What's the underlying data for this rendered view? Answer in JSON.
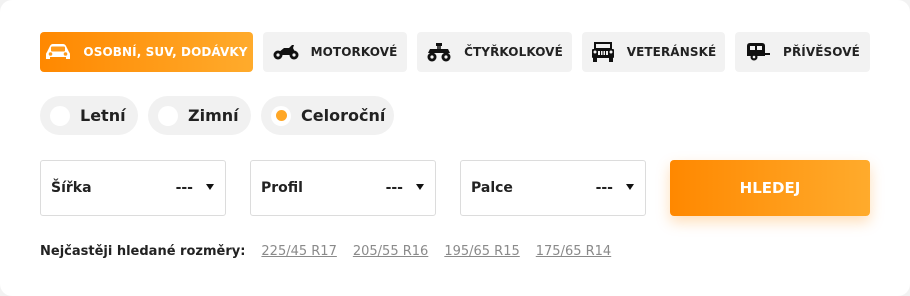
{
  "vehicle_tabs": [
    {
      "label": "OSOBNÍ, SUV, DODÁVKY",
      "icon": "car-icon",
      "active": true
    },
    {
      "label": "MOTORKOVÉ",
      "icon": "motorcycle-icon",
      "active": false
    },
    {
      "label": "ČTYŘKOLKOVÉ",
      "icon": "quad-bike-icon",
      "active": false
    },
    {
      "label": "VETERÁNSKÉ",
      "icon": "vintage-car-icon",
      "active": false
    },
    {
      "label": "PŘÍVĚSOVÉ",
      "icon": "trailer-icon",
      "active": false
    }
  ],
  "seasons": [
    {
      "label": "Letní",
      "selected": false
    },
    {
      "label": "Zimní",
      "selected": false
    },
    {
      "label": "Celoroční",
      "selected": true
    }
  ],
  "filters": [
    {
      "label": "Šířka",
      "value": "---"
    },
    {
      "label": "Profil",
      "value": "---"
    },
    {
      "label": "Palce",
      "value": "---"
    }
  ],
  "search_button": "HLEDEJ",
  "popular": {
    "title": "Nejčastěji hledané rozměry:",
    "sizes": [
      "225/45 R17",
      "205/55 R16",
      "195/65 R15",
      "175/65 R14"
    ]
  },
  "colors": {
    "accent": "#ff8800",
    "accent_light": "#ffab2c",
    "radio_dot": "#ffa726"
  }
}
